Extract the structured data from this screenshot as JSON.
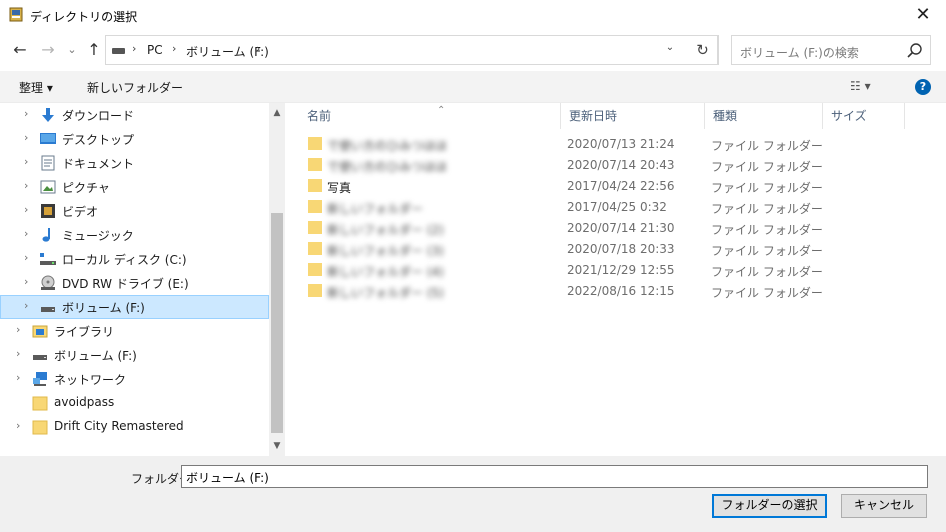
{
  "window": {
    "title": "ディレクトリの選択",
    "close_glyph": "✕",
    "icon": "app-icon"
  },
  "nav": {
    "back_glyph": "←",
    "forward_glyph": "→",
    "recent_glyph": "⌄",
    "up_glyph": "↑",
    "address": {
      "sep": "›",
      "crumbs": [
        "PC",
        "ボリューム (F:)"
      ],
      "dropdown_glyph": "⌄"
    },
    "refresh_glyph": "↻",
    "search_placeholder": "ボリューム (F:)の検索"
  },
  "toolbar": {
    "organize_label": "整理 ▾",
    "new_folder_label": "新しいフォルダー",
    "view_label": "☷ ▾",
    "help_label": "?"
  },
  "sidebar": {
    "expand_glyph": "›",
    "items": [
      {
        "label": "ダウンロード",
        "icon": "download-icon"
      },
      {
        "label": "デスクトップ",
        "icon": "desktop-icon"
      },
      {
        "label": "ドキュメント",
        "icon": "documents-icon"
      },
      {
        "label": "ピクチャ",
        "icon": "pictures-icon"
      },
      {
        "label": "ビデオ",
        "icon": "video-icon"
      },
      {
        "label": "ミュージック",
        "icon": "music-icon"
      },
      {
        "label": "ローカル ディスク (C:)",
        "icon": "local-disk-icon"
      },
      {
        "label": "DVD RW ドライブ (E:)",
        "icon": "dvd-drive-icon"
      },
      {
        "label": "ボリューム (F:)",
        "icon": "drive-icon",
        "selected": true
      },
      {
        "label": "ライブラリ",
        "icon": "library-icon"
      },
      {
        "label": "ボリューム (F:)",
        "icon": "drive-icon"
      },
      {
        "label": "ネットワーク",
        "icon": "network-icon"
      },
      {
        "label": "avoidpass",
        "icon": "folder-icon"
      },
      {
        "label": "Drift City Remastered",
        "icon": "folder-icon"
      }
    ]
  },
  "scrollbar": {
    "up_glyph": "▲",
    "down_glyph": "▼"
  },
  "columns": {
    "sort_glyph": "⌃",
    "name": "名前",
    "modified": "更新日時",
    "type": "種類",
    "size": "サイズ"
  },
  "files": [
    {
      "name": "で使い方のひみつほほ",
      "date": "2020/07/13 21:24",
      "type": "ファイル フォルダー",
      "blurred": true
    },
    {
      "name": "で使い方のひみつほほ",
      "date": "2020/07/14 20:43",
      "type": "ファイル フォルダー",
      "blurred": true
    },
    {
      "name": "写真",
      "date": "2017/04/24 22:56",
      "type": "ファイル フォルダー",
      "blurred": false
    },
    {
      "name": "新しいフォルダー",
      "date": "2017/04/25 0:32",
      "type": "ファイル フォルダー",
      "blurred": true
    },
    {
      "name": "新しいフォルダー (2)",
      "date": "2020/07/14 21:30",
      "type": "ファイル フォルダー",
      "blurred": true
    },
    {
      "name": "新しいフォルダー (3)",
      "date": "2020/07/18 20:33",
      "type": "ファイル フォルダー",
      "blurred": true
    },
    {
      "name": "新しいフォルダー (4)",
      "date": "2021/12/29 12:55",
      "type": "ファイル フォルダー",
      "blurred": true
    },
    {
      "name": "新しいフォルダー (5)",
      "date": "2022/08/16 12:15",
      "type": "ファイル フォルダー",
      "blurred": true
    }
  ],
  "footer": {
    "folder_label": "フォルダー:",
    "folder_value": "ボリューム (F:)",
    "select_button": "フォルダーの選択",
    "cancel_button": "キャンセル"
  },
  "colors": {
    "selection_bg": "#cce8ff",
    "selection_border": "#99d1ff",
    "folder_yellow": "#f8d775",
    "accent": "#0078d7"
  }
}
